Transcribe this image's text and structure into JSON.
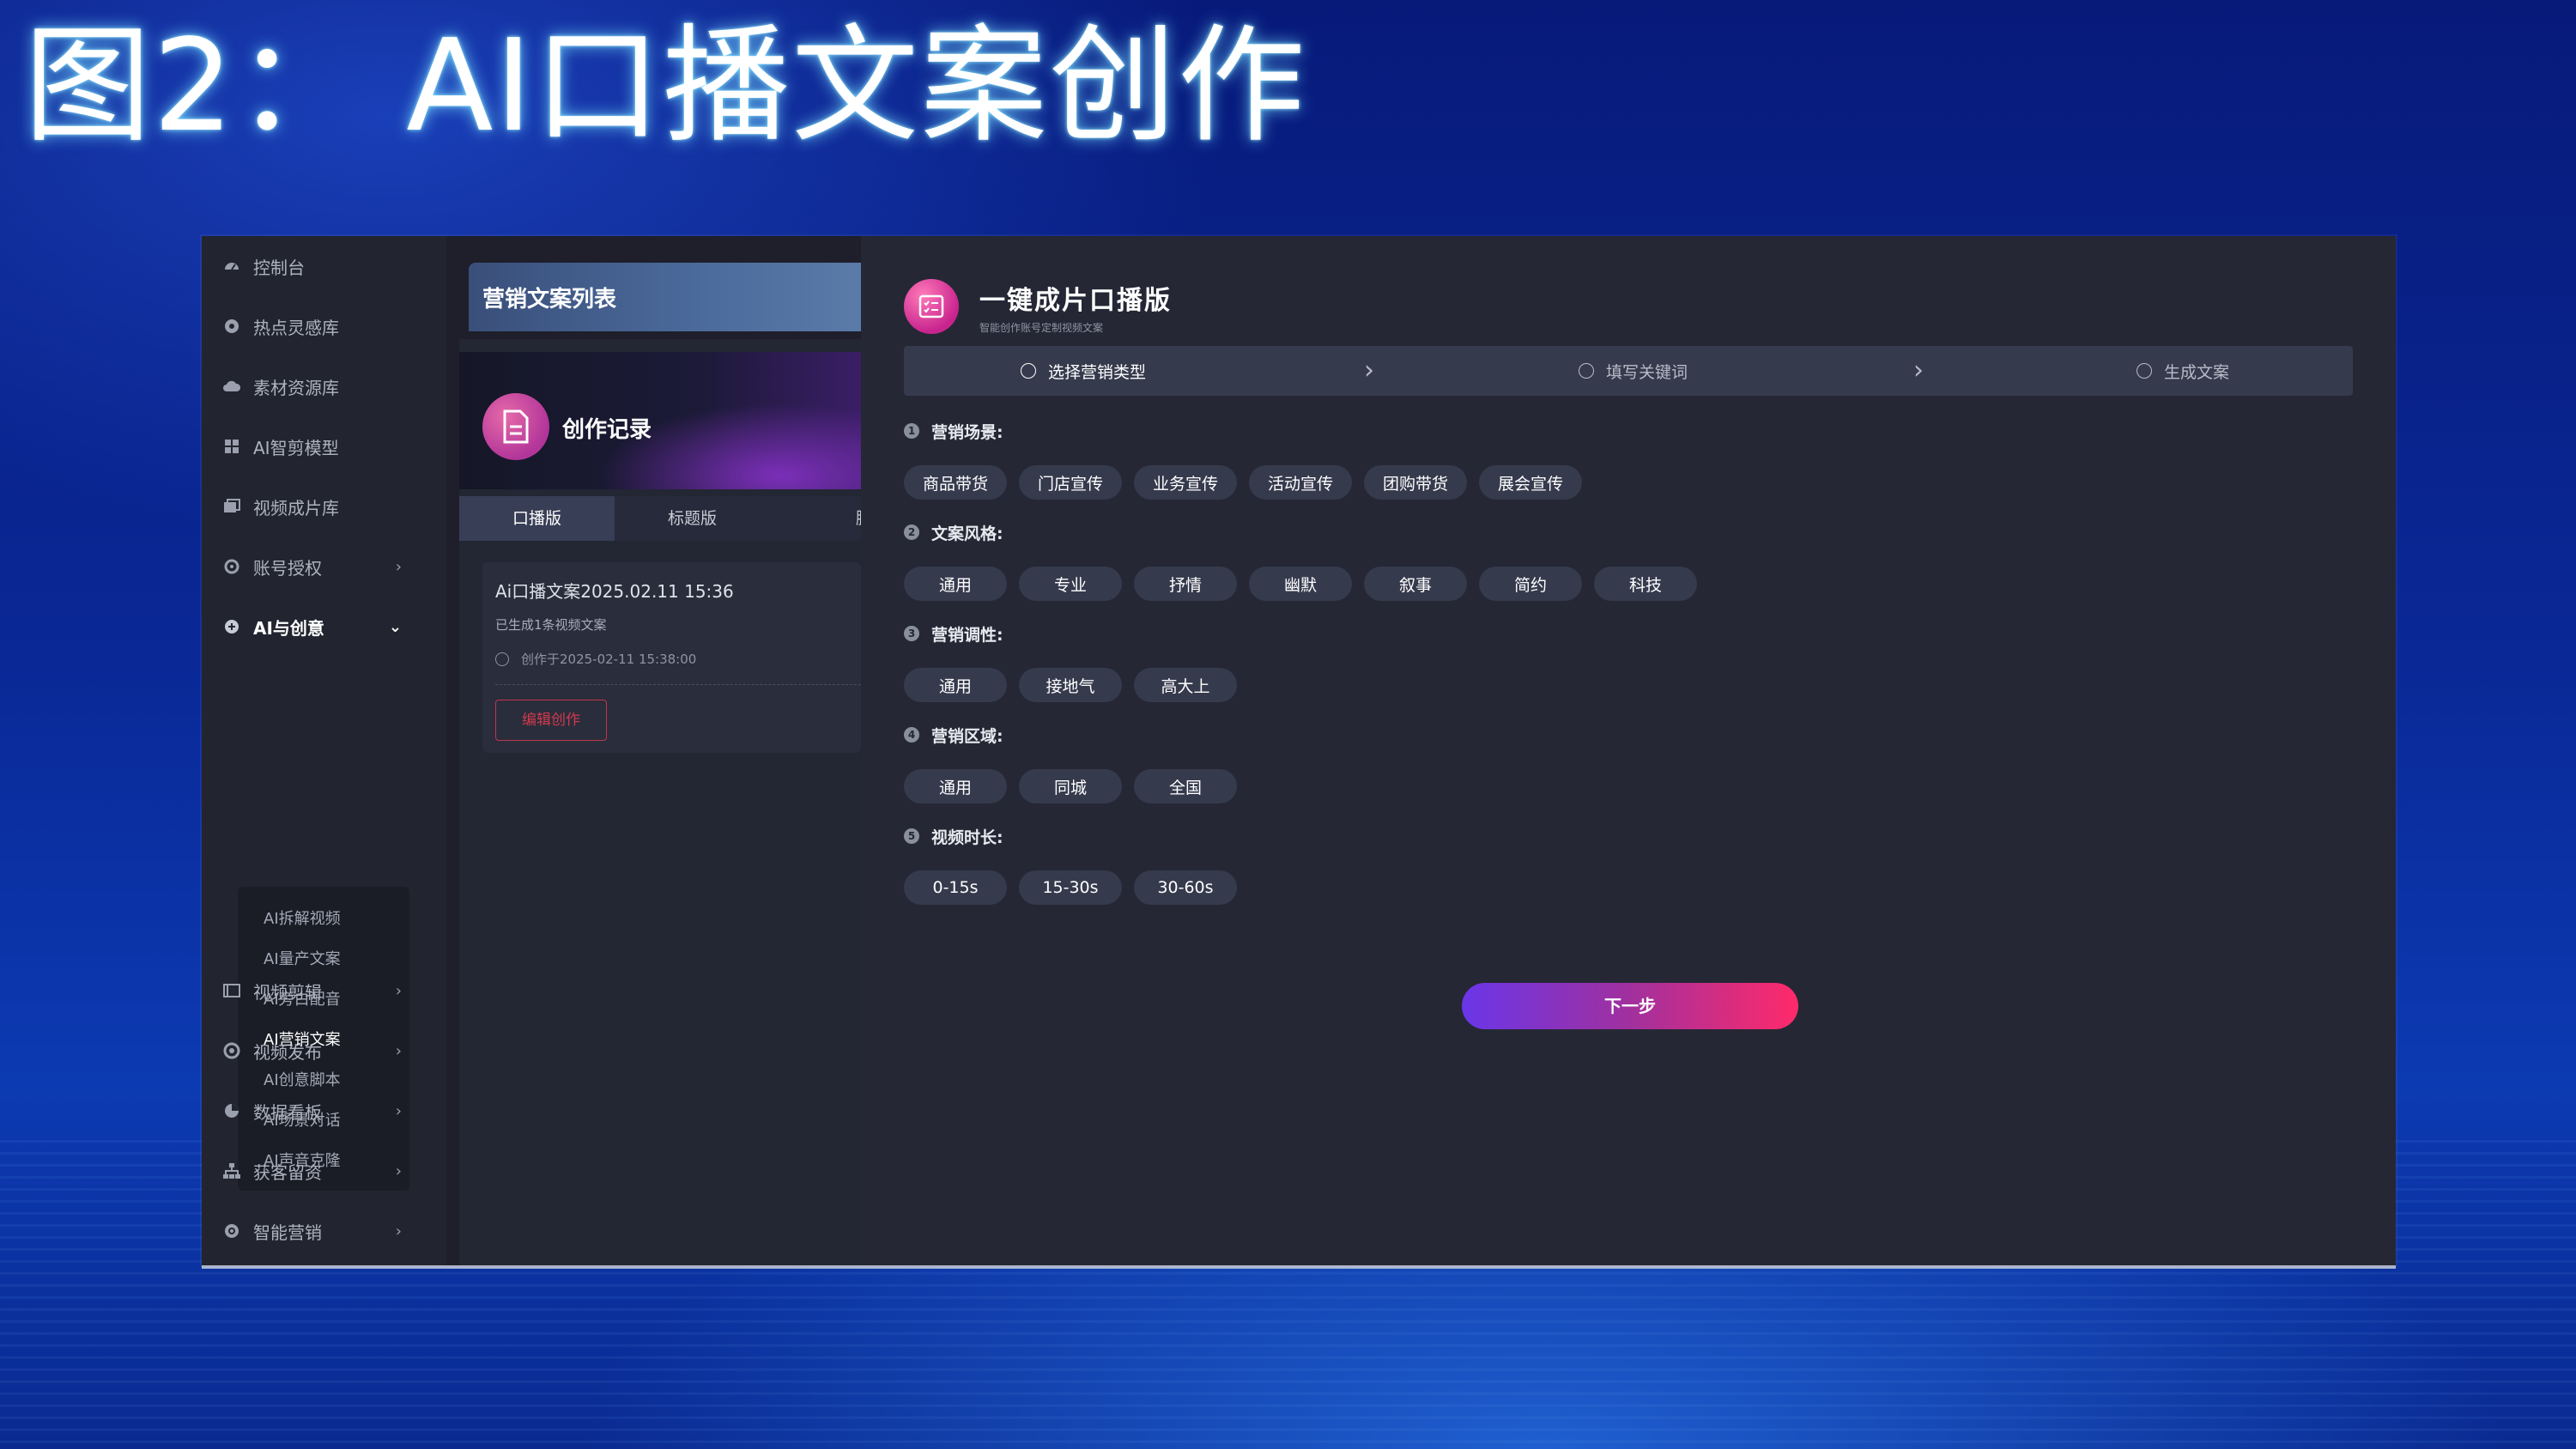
{
  "slide": {
    "title": "图2： AI口播文案创作"
  },
  "sidebar": {
    "items": [
      {
        "label": "控制台",
        "icon": "dashboard-icon"
      },
      {
        "label": "热点灵感库",
        "icon": "fire-icon"
      },
      {
        "label": "素材资源库",
        "icon": "cloud-icon"
      },
      {
        "label": "AI智剪模型",
        "icon": "grid-icon"
      },
      {
        "label": "视频成片库",
        "icon": "film-icon"
      },
      {
        "label": "账号授权",
        "icon": "key-icon",
        "chevron": "›"
      },
      {
        "label": "AI与创意",
        "icon": "brain-icon",
        "chevron": "⌄"
      }
    ],
    "submenu": [
      "AI拆解视频",
      "AI量产文案",
      "AI旁白配音",
      "AI营销文案",
      "AI创意脚本",
      "AI场景对话",
      "AI声音克隆"
    ],
    "bottom_items": [
      {
        "label": "视频剪辑",
        "icon": "scissors-icon",
        "chevron": "›"
      },
      {
        "label": "视频发布",
        "icon": "publish-icon",
        "chevron": "›"
      },
      {
        "label": "数据看板",
        "icon": "pie-icon",
        "chevron": "›"
      },
      {
        "label": "获客留资",
        "icon": "org-icon",
        "chevron": "›"
      },
      {
        "label": "智能营销",
        "icon": "target-icon",
        "chevron": "›"
      }
    ]
  },
  "list_panel": {
    "title": "营销文案列表",
    "record_title": "创作记录",
    "tabs": [
      "口播版",
      "标题版",
      "脚本版"
    ],
    "card": {
      "title": "Ai口播文案2025.02.11 15:36",
      "subtitle": "已生成1条视频文案",
      "time": "创作于2025-02-11 15:38:00",
      "edit_label": "编辑创作"
    }
  },
  "main": {
    "title": "一键成片口播版",
    "subtitle": "智能创作账号定制视频文案",
    "steps": [
      "选择营销类型",
      "填写关键词",
      "生成文案"
    ],
    "sections": [
      {
        "num": "1",
        "label": "营销场景:",
        "options": [
          "商品带货",
          "门店宣传",
          "业务宣传",
          "活动宣传",
          "团购带货",
          "展会宣传"
        ]
      },
      {
        "num": "2",
        "label": "文案风格:",
        "options": [
          "通用",
          "专业",
          "抒情",
          "幽默",
          "叙事",
          "简约",
          "科技"
        ]
      },
      {
        "num": "3",
        "label": "营销调性:",
        "options": [
          "通用",
          "接地气",
          "高大上"
        ]
      },
      {
        "num": "4",
        "label": "营销区域:",
        "options": [
          "通用",
          "同城",
          "全国"
        ]
      },
      {
        "num": "5",
        "label": "视频时长:",
        "options": [
          "0-15s",
          "15-30s",
          "30-60s"
        ]
      }
    ],
    "next_label": "下一步"
  },
  "colors": {
    "accent_start": "#6a36e8",
    "accent_end": "#ff2a6a",
    "panel": "#252735",
    "chip": "#363a4d"
  }
}
